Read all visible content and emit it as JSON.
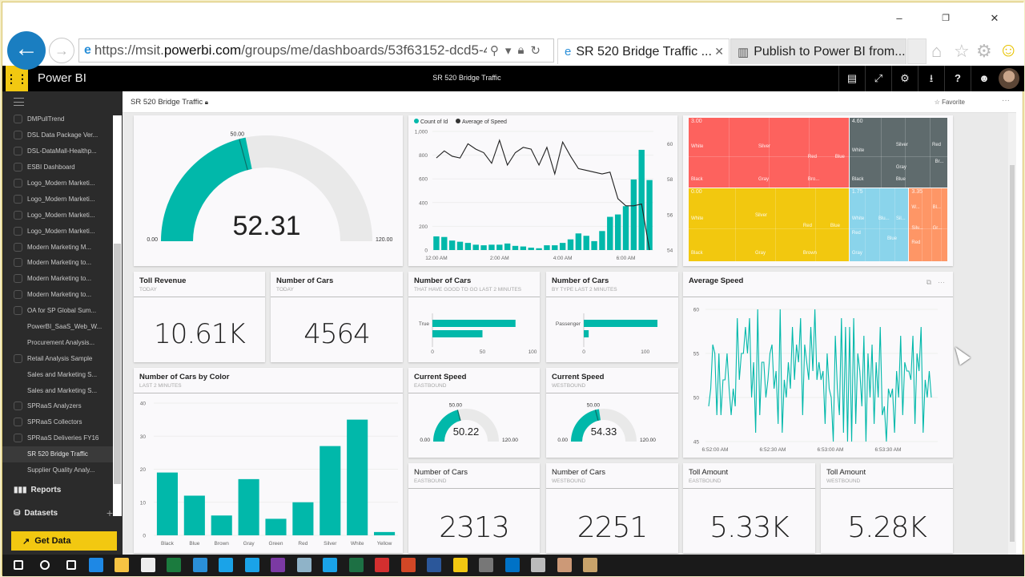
{
  "browser": {
    "window_controls": {
      "minimize": "–",
      "restore": "❐",
      "close": "✕"
    },
    "url_prefix": "https://msit.",
    "url_domain": "powerbi.com",
    "url_path": "/groups/me/dashboards/53f63152-dcd5-4:",
    "tabs": [
      {
        "label": "SR 520 Bridge Traffic ...",
        "active": true
      },
      {
        "label": "Publish to Power BI from...",
        "active": false
      }
    ],
    "icons": {
      "home": "⌂",
      "favorites": "☆",
      "settings": "⚙",
      "feedback": "☺"
    }
  },
  "appbar": {
    "app_name": "Power BI",
    "dashboard_title": "SR 520 Bridge Traffic",
    "buttons": [
      {
        "name": "comment",
        "glyph": "▤"
      },
      {
        "name": "fullscreen",
        "glyph": "⤢"
      },
      {
        "name": "settings",
        "glyph": "⚙"
      },
      {
        "name": "download",
        "glyph": "⭳"
      },
      {
        "name": "help",
        "glyph": "?"
      },
      {
        "name": "feedback",
        "glyph": "☻"
      }
    ]
  },
  "sidebar": {
    "dashboards": [
      {
        "label": "DMPullTrend",
        "icon": true
      },
      {
        "label": "DSL Data Package Ver...",
        "icon": true
      },
      {
        "label": "DSL-DataMall-Healthp...",
        "icon": true
      },
      {
        "label": "ESBI Dashboard",
        "icon": true
      },
      {
        "label": "Logo_Modern Marketi...",
        "icon": true
      },
      {
        "label": "Logo_Modern Marketi...",
        "icon": true
      },
      {
        "label": "Logo_Modern Marketi...",
        "icon": true
      },
      {
        "label": "Logo_Modern Marketi...",
        "icon": true
      },
      {
        "label": "Modern Marketing M...",
        "icon": true
      },
      {
        "label": "Modern Marketing to...",
        "icon": true
      },
      {
        "label": "Modern Marketing to...",
        "icon": true
      },
      {
        "label": "Modern Marketing to...",
        "icon": true
      },
      {
        "label": "OA for SP Global Sum...",
        "icon": true
      },
      {
        "label": "PowerBI_SaaS_Web_W...",
        "icon": false
      },
      {
        "label": "Procurement Analysis...",
        "icon": false
      },
      {
        "label": "Retail Analysis Sample",
        "icon": true
      },
      {
        "label": "Sales and Marketing S...",
        "icon": false
      },
      {
        "label": "Sales and Marketing S...",
        "icon": false
      },
      {
        "label": "SPRaaS Analyzers",
        "icon": true
      },
      {
        "label": "SPRaaS Collectors",
        "icon": true
      },
      {
        "label": "SPRaaS Deliveries FY16",
        "icon": true
      },
      {
        "label": "SR 520 Bridge Traffic",
        "icon": false,
        "active": true
      },
      {
        "label": "Supplier Quality Analy...",
        "icon": false
      }
    ],
    "reports_label": "Reports",
    "datasets_label": "Datasets",
    "add_label": "+",
    "get_data_label": "Get Data"
  },
  "dashboard": {
    "title": "SR 520 Bridge Traffic",
    "favorite_label": "Favorite",
    "more_label": "···"
  },
  "tiles": {
    "main_gauge": {
      "value": "52.31",
      "min": "0.00",
      "max": "120.00",
      "target": "50.00",
      "gauge": {
        "value": 52.31,
        "min": 0,
        "max": 120,
        "target": 50
      }
    },
    "toll_revenue": {
      "title": "Toll Revenue",
      "subtitle": "TODAY",
      "value": "10.61K"
    },
    "cars_today": {
      "title": "Number of Cars",
      "subtitle": "TODAY",
      "value": "4564"
    },
    "cars_good_to_go": {
      "title": "Number of Cars",
      "subtitle": "THAT HAVE GOOD TO GO LAST 2 MINUTES"
    },
    "cars_by_type": {
      "title": "Number of Cars",
      "subtitle": "BY TYPE LAST 2 MINUTES"
    },
    "avg_speed": {
      "title": "Average Speed"
    },
    "cars_by_color": {
      "title": "Number of Cars by Color",
      "subtitle": "LAST 2 MINUTES"
    },
    "speed_east": {
      "title": "Current Speed",
      "subtitle": "EASTBOUND",
      "value": "50.22",
      "min": "0.00",
      "max": "120.00",
      "target": "50.00",
      "gauge": {
        "value": 50.22,
        "min": 0,
        "max": 120,
        "target": 50
      }
    },
    "speed_west": {
      "title": "Current Speed",
      "subtitle": "WESTBOUND",
      "value": "54.33",
      "min": "0.00",
      "max": "120.00",
      "target": "50.00",
      "gauge": {
        "value": 54.33,
        "min": 0,
        "max": 120,
        "target": 50
      }
    },
    "cars_east": {
      "title": "Number of Cars",
      "subtitle": "EASTBOUND",
      "value": "2313"
    },
    "cars_west": {
      "title": "Number of Cars",
      "subtitle": "WESTBOUND",
      "value": "2251"
    },
    "toll_east": {
      "title": "Toll Amount",
      "subtitle": "EASTBOUND",
      "value": "5.33K"
    },
    "toll_west": {
      "title": "Toll Amount",
      "subtitle": "WESTBOUND",
      "value": "5.28K"
    }
  },
  "colors": {
    "accent": "#01b8aa",
    "brand_yellow": "#f2c811",
    "gauge_track": "#e9e9e9",
    "treemap": [
      "#fd625e",
      "#5f6b6d",
      "#f2c80f",
      "#8ad4eb",
      "#fe9666"
    ]
  },
  "chart_data": [
    {
      "id": "combo",
      "type": "bar+line",
      "legend": [
        "Count of Id",
        "Average of Speed"
      ],
      "x_ticks": [
        "12:00 AM",
        "2:00 AM",
        "4:00 AM",
        "6:00 AM"
      ],
      "y_left_ticks": [
        "0",
        "200",
        "400",
        "600",
        "800",
        "1,000"
      ],
      "y_left_range": [
        0,
        1000
      ],
      "y_right_ticks": [
        "54",
        "56",
        "58",
        "60"
      ],
      "y_right_range": [
        54,
        60.7
      ],
      "series": [
        {
          "name": "Count of Id",
          "values": [
            115,
            110,
            80,
            70,
            60,
            45,
            40,
            45,
            45,
            55,
            35,
            30,
            20,
            15,
            40,
            40,
            60,
            90,
            140,
            120,
            75,
            160,
            280,
            300,
            370,
            595,
            845,
            590
          ]
        },
        {
          "name": "Average of Speed",
          "values": [
            59.2,
            59.6,
            59.3,
            59.2,
            60,
            59.7,
            59.5,
            58.9,
            60.2,
            58.8,
            59.5,
            59.8,
            59.7,
            58.8,
            59.8,
            58.3,
            60.1,
            59.3,
            58.6,
            58.5,
            58.4,
            58.3,
            58.4,
            56.9,
            56.5,
            56.5,
            56.6,
            54
          ]
        }
      ]
    },
    {
      "id": "treemap",
      "type": "treemap",
      "groups": [
        {
          "label": "3.00",
          "children": [
            "White",
            "Silver",
            "Red",
            "Blue",
            "Black",
            "Gray",
            "Bro..."
          ]
        },
        {
          "label": "4.60",
          "children": [
            "White",
            "Silver",
            "Red",
            "Gray",
            "Br...",
            "Black",
            "Blue"
          ]
        },
        {
          "label": "0.00",
          "children": [
            "White",
            "Silver",
            "Red",
            "Blue",
            "Black",
            "Gray",
            "Brown"
          ]
        },
        {
          "label": "1.75",
          "children": [
            "White",
            "Blu...",
            "Sil...",
            "Red",
            "Blue",
            "Gray"
          ]
        },
        {
          "label": "3.35",
          "children": [
            "W...",
            "Bl...",
            "Silv...",
            "Gr...",
            "Red"
          ]
        }
      ]
    },
    {
      "id": "good_to_go",
      "type": "bar",
      "orientation": "horizontal",
      "categories": [
        "True",
        ""
      ],
      "values": [
        83,
        50
      ],
      "x_ticks": [
        "0",
        "50",
        "100"
      ],
      "xlim": [
        0,
        100
      ]
    },
    {
      "id": "by_type",
      "type": "bar",
      "orientation": "horizontal",
      "categories": [
        "Passenger",
        ""
      ],
      "values": [
        120,
        8
      ],
      "x_ticks": [
        "0",
        "100"
      ],
      "xlim": [
        0,
        150
      ]
    },
    {
      "id": "avg_speed",
      "type": "line",
      "title": "Average Speed",
      "y_ticks": [
        "45",
        "50",
        "55",
        "60"
      ],
      "ylim": [
        45,
        60
      ],
      "x_ticks": [
        "6:52:00 AM",
        "6:52:30 AM",
        "6:53:00 AM",
        "6:53:30 AM"
      ],
      "values": [
        49,
        51,
        56,
        55,
        48,
        55,
        48,
        52,
        52,
        55,
        51,
        48,
        51,
        49,
        59,
        52,
        55,
        55,
        58,
        55,
        59,
        50,
        54,
        46,
        60,
        48,
        54,
        54,
        50,
        52,
        55,
        56,
        51,
        53,
        47,
        60,
        46,
        52,
        50,
        54,
        51,
        58,
        52,
        56,
        54,
        59,
        48,
        56,
        54,
        52,
        58,
        53,
        60,
        52,
        54,
        52,
        53,
        47,
        55,
        51,
        50,
        45,
        57,
        51,
        48,
        59,
        46,
        58,
        45,
        58,
        45,
        59,
        47,
        55,
        53,
        49,
        57,
        45,
        55,
        50,
        56,
        47,
        54,
        50,
        58,
        48,
        49,
        45,
        51,
        50,
        51,
        46,
        53,
        50,
        57,
        48,
        54,
        53,
        53,
        52,
        57,
        47,
        55,
        53,
        58,
        46,
        52,
        50,
        53,
        50
      ]
    },
    {
      "id": "by_color",
      "type": "bar",
      "title": "Number of Cars by Color",
      "categories": [
        "Black",
        "Blue",
        "Brown",
        "Gray",
        "Green",
        "Red",
        "Silver",
        "White",
        "Yellow"
      ],
      "values": [
        19,
        12,
        6,
        17,
        5,
        10,
        27,
        35,
        1
      ],
      "y_ticks": [
        "0",
        "10",
        "20",
        "30",
        "40"
      ],
      "ylim": [
        0,
        40
      ]
    }
  ],
  "taskbar": {
    "icons": [
      "windows-start",
      "cortana",
      "task-view",
      "edge",
      "file-explorer",
      "store",
      "app-green",
      "internet-explorer",
      "skype-busy",
      "skype-away",
      "onenote",
      "app-gray",
      "skype",
      "excel",
      "acrobat",
      "powerpoint",
      "word",
      "powerbi",
      "phone",
      "outlook",
      "app-paint",
      "app-other",
      "media"
    ]
  }
}
